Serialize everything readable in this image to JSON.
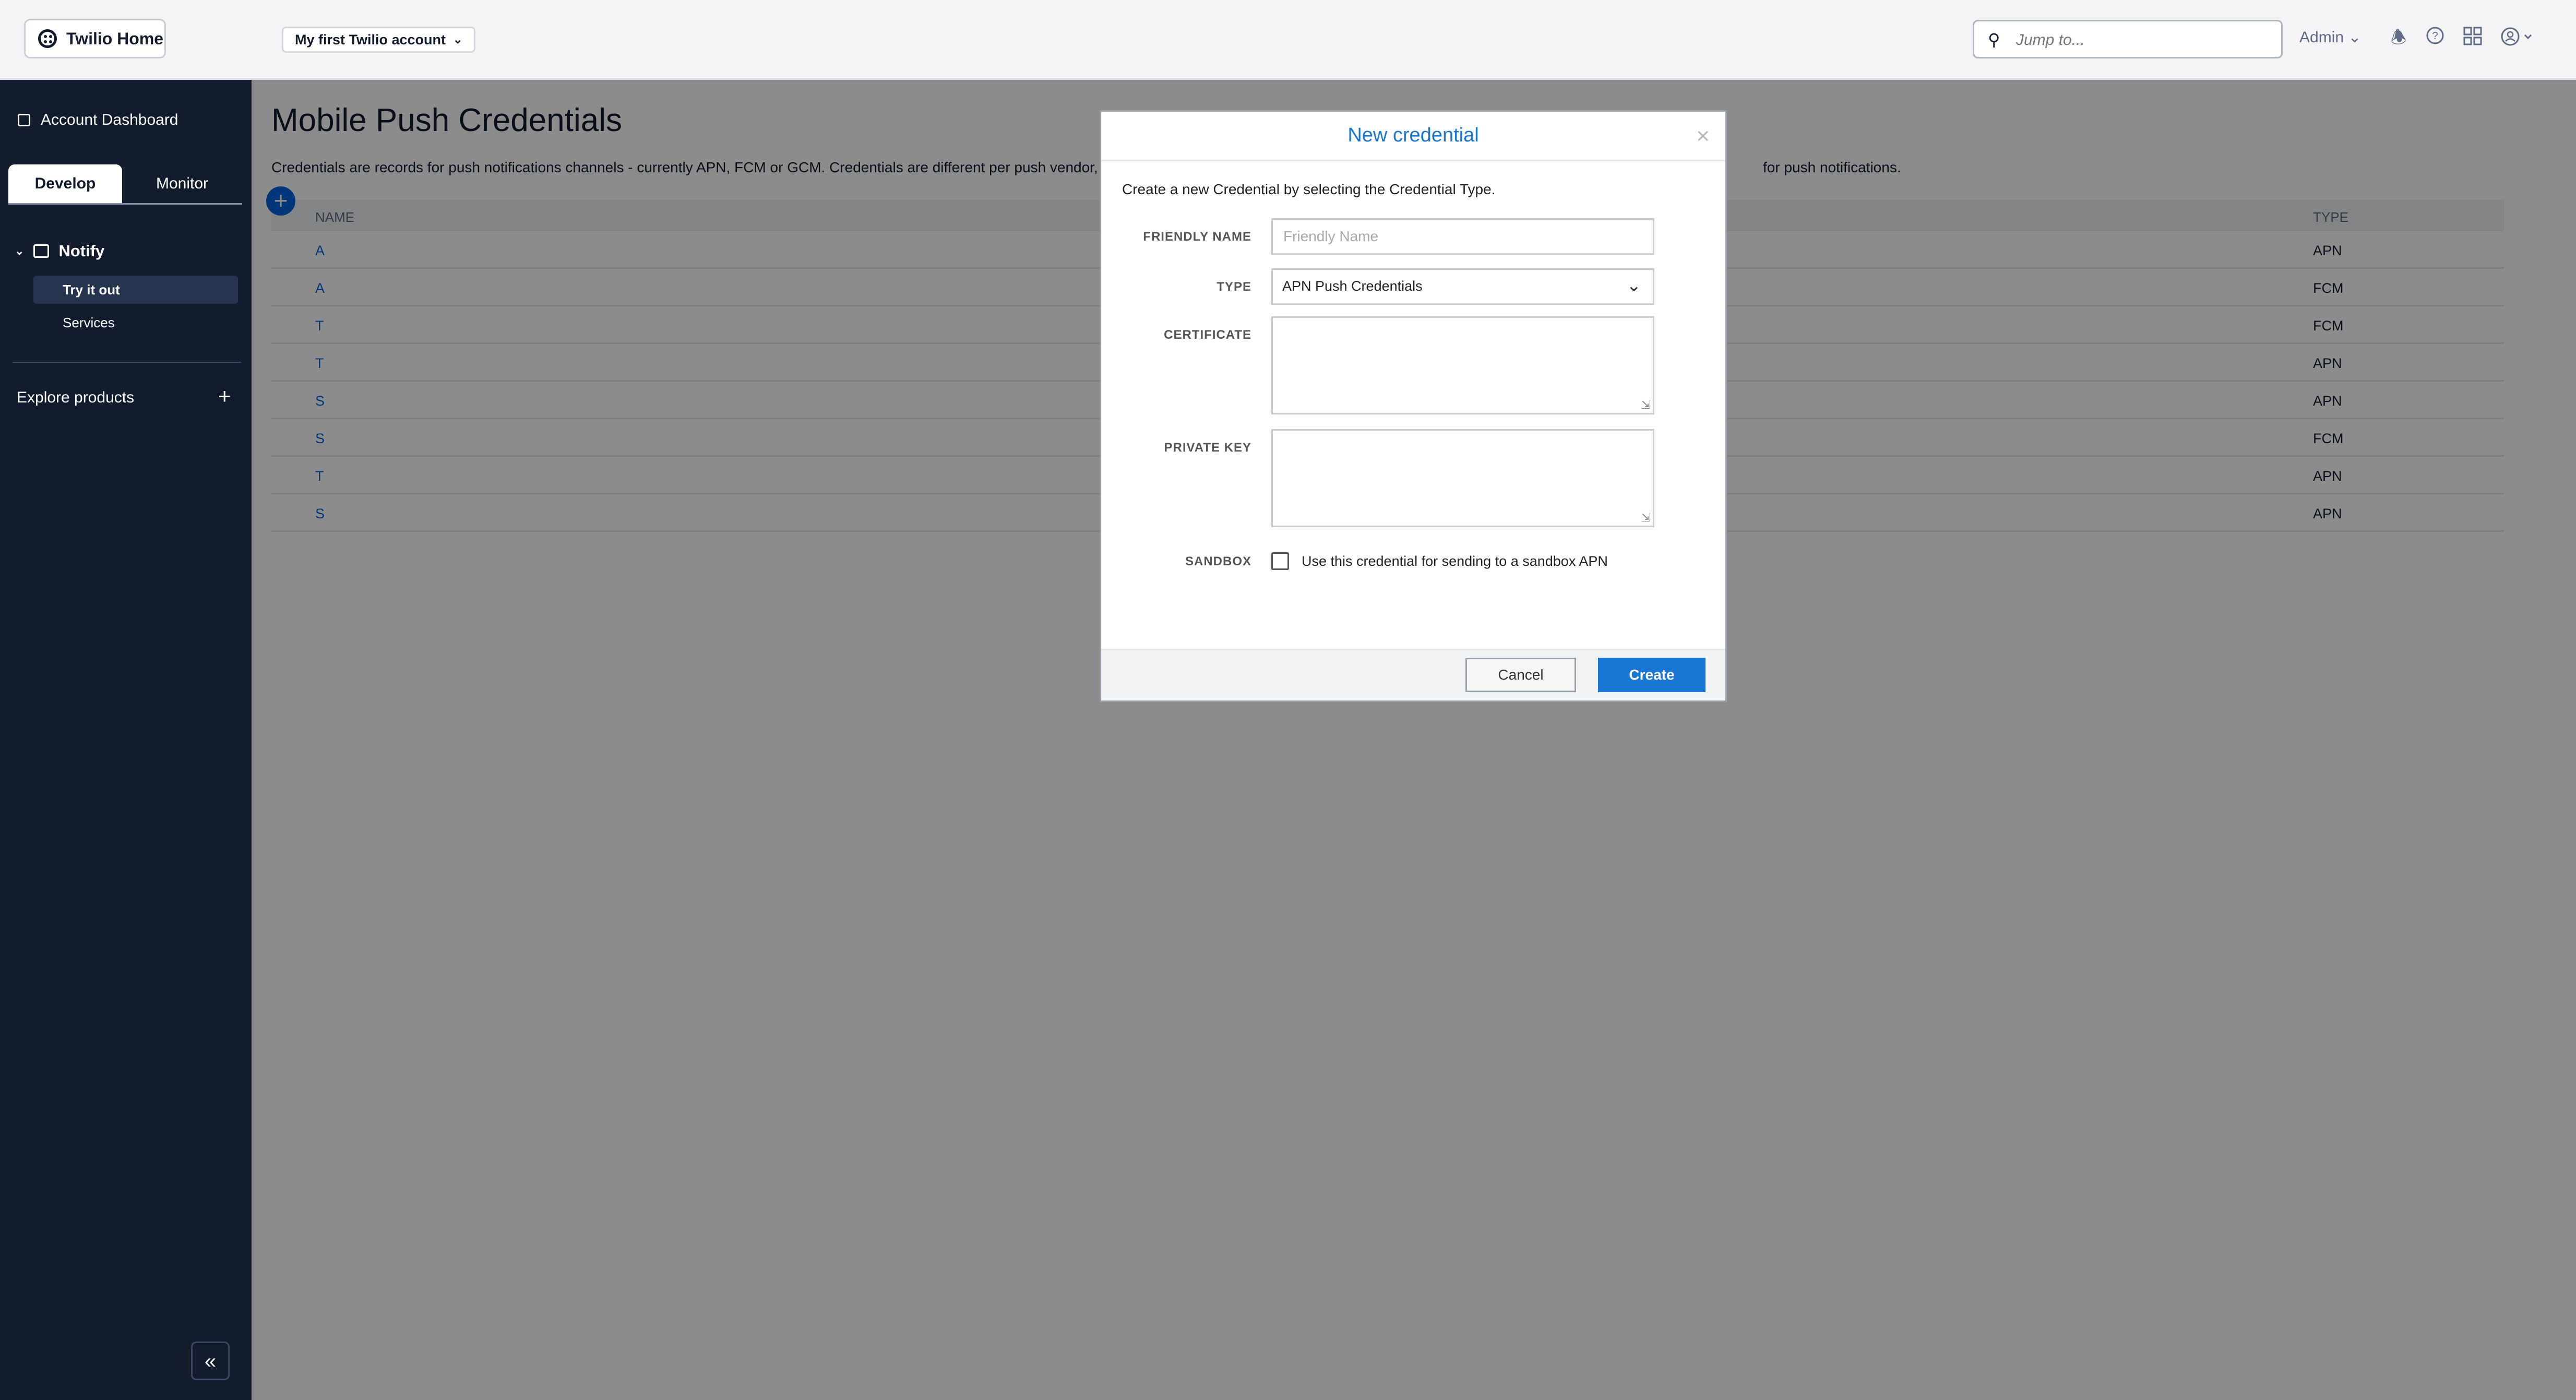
{
  "topbar": {
    "home_label": "Twilio Home",
    "account_label": "My first Twilio account",
    "search_placeholder": "Jump to...",
    "admin_label": "Admin"
  },
  "sidebar": {
    "dashboard_label": "Account Dashboard",
    "tabs": [
      {
        "label": "Develop"
      },
      {
        "label": "Monitor"
      }
    ],
    "section_label": "Notify",
    "items": [
      {
        "label": "Try it out"
      },
      {
        "label": "Services"
      }
    ],
    "explore_label": "Explore products"
  },
  "main": {
    "title": "Mobile Push Credentials",
    "description": "Credentials are records for push notifications channels - currently APN, FCM or GCM. Credentials are different per push vendor, and are",
    "description_tail": "for push notifications.",
    "columns": {
      "name": "NAME",
      "type": "TYPE"
    },
    "rows": [
      {
        "name": "A",
        "type": "APN"
      },
      {
        "name": "A",
        "type": "FCM"
      },
      {
        "name": "T",
        "type": "FCM"
      },
      {
        "name": "T",
        "type": "APN"
      },
      {
        "name": "S",
        "type": "APN"
      },
      {
        "name": "S",
        "type": "FCM"
      },
      {
        "name": "T",
        "type": "APN"
      },
      {
        "name": "S",
        "type": "APN"
      }
    ]
  },
  "modal": {
    "title": "New credential",
    "intro": "Create a new Credential by selecting the Credential Type.",
    "friendly_name_label": "FRIENDLY NAME",
    "friendly_name_placeholder": "Friendly Name",
    "friendly_name_value": "",
    "type_label": "TYPE",
    "type_value": "APN Push Credentials",
    "certificate_label": "CERTIFICATE",
    "private_key_label": "PRIVATE KEY",
    "sandbox_label": "SANDBOX",
    "sandbox_text": "Use this credential for sending to a sandbox APN",
    "sandbox_checked": false,
    "cancel_label": "Cancel",
    "create_label": "Create"
  },
  "icons": {
    "search": "search-icon",
    "bell": "bell-icon",
    "help": "help-icon",
    "apps": "grid-icon",
    "user": "user-icon",
    "close": "close-icon"
  },
  "colors": {
    "sidebar_bg": "#121c2d",
    "accent": "#0263e0",
    "modal_accent": "#1976d2"
  }
}
